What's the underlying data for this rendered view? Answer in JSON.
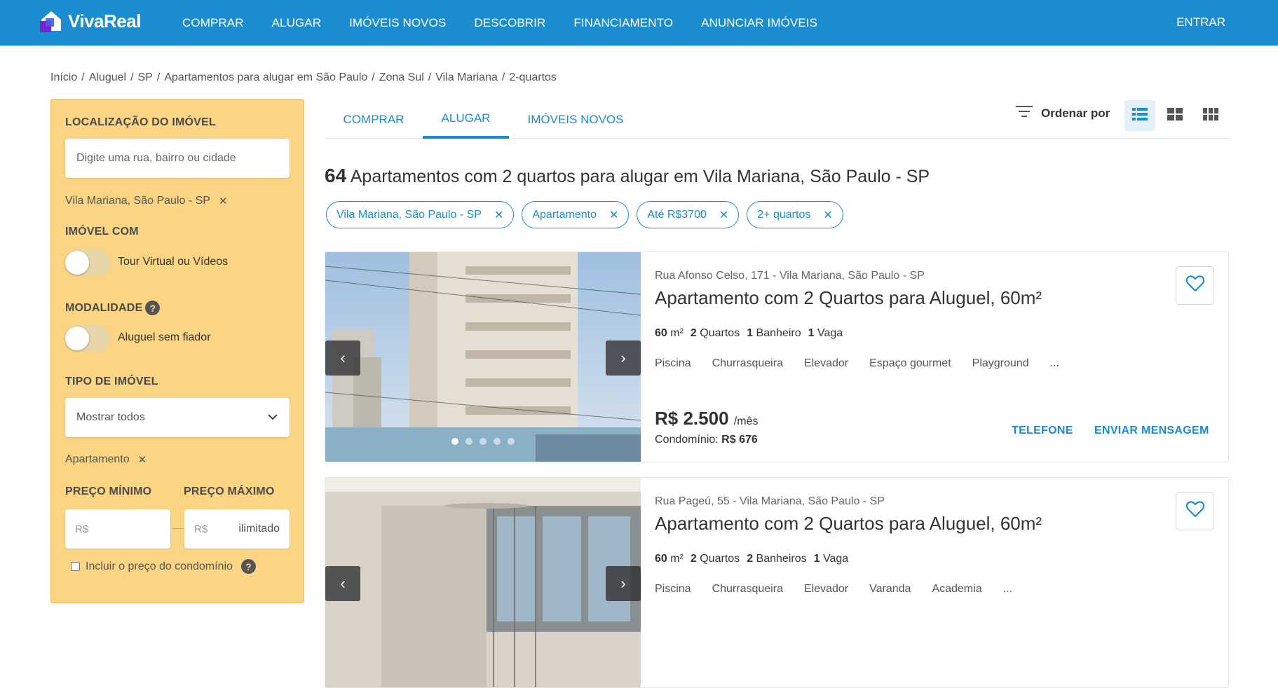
{
  "header": {
    "logo_text": "VivaReal",
    "nav": [
      "COMPRAR",
      "ALUGAR",
      "IMÓVEIS NOVOS",
      "DESCOBRIR",
      "FINANCIAMENTO",
      "ANUNCIAR IMÓVEIS"
    ],
    "enter": "ENTRAR",
    "brand_color": "#1b8ccf"
  },
  "breadcrumb": [
    "Início",
    "Aluguel",
    "SP",
    "Apartamentos para alugar em São Paulo",
    "Zona Sul",
    "Vila Mariana",
    "2-quartos"
  ],
  "sidebar": {
    "location_label": "LOCALIZAÇÃO DO IMÓVEL",
    "location_placeholder": "Digite uma rua, bairro ou cidade",
    "location_chip": "Vila Mariana, São Paulo - SP",
    "imovel_com_label": "IMÓVEL COM",
    "tour_label": "Tour Virtual ou Vídeos",
    "modalidade_label": "MODALIDADE",
    "fiador_label": "Aluguel sem fiador",
    "tipo_label": "TIPO DE IMÓVEL",
    "tipo_value": "Mostrar todos",
    "tipo_chip": "Apartamento",
    "preco_min_label": "PREÇO MÍNIMO",
    "preco_max_label": "PREÇO MÁXIMO",
    "currency": "R$",
    "preco_max_value": "ilimitado",
    "condominio_label": "Incluir o preço do condomínio",
    "panel_color": "#fcd584"
  },
  "tabs": [
    "COMPRAR",
    "ALUGAR",
    "IMÓVEIS NOVOS"
  ],
  "active_tab": "ALUGAR",
  "sort_label": "Ordenar por",
  "results": {
    "count": "64",
    "text": "Apartamentos com 2 quartos para alugar em Vila Mariana, São Paulo - SP"
  },
  "filters": [
    "Vila Mariana, São Paulo - SP",
    "Apartamento",
    "Até R$3700",
    "2+ quartos"
  ],
  "cards": [
    {
      "address": "Rua Afonso Celso, 171 - Vila Mariana, São Paulo - SP",
      "title": "Apartamento com 2 Quartos para Aluguel, 60m²",
      "area_value": "60",
      "area_unit": "m²",
      "rooms_value": "2",
      "rooms_label": "Quartos",
      "baths_value": "1",
      "baths_label": "Banheiro",
      "parking_value": "1",
      "parking_label": "Vaga",
      "amenities": [
        "Piscina",
        "Churrasqueira",
        "Elevador",
        "Espaço gourmet",
        "Playground",
        "..."
      ],
      "price": "R$ 2.500",
      "price_suffix": "/mês",
      "condo_label": "Condomínio:",
      "condo_value": "R$ 676",
      "phone_label": "TELEFONE",
      "message_label": "ENVIAR MENSAGEM"
    },
    {
      "address": "Rua Pageú, 55 - Vila Mariana, São Paulo - SP",
      "title": "Apartamento com 2 Quartos para Aluguel, 60m²",
      "area_value": "60",
      "area_unit": "m²",
      "rooms_value": "2",
      "rooms_label": "Quartos",
      "baths_value": "2",
      "baths_label": "Banheiros",
      "parking_value": "1",
      "parking_label": "Vaga",
      "amenities": [
        "Piscina",
        "Churrasqueira",
        "Elevador",
        "Varanda",
        "Academia",
        "..."
      ]
    }
  ]
}
